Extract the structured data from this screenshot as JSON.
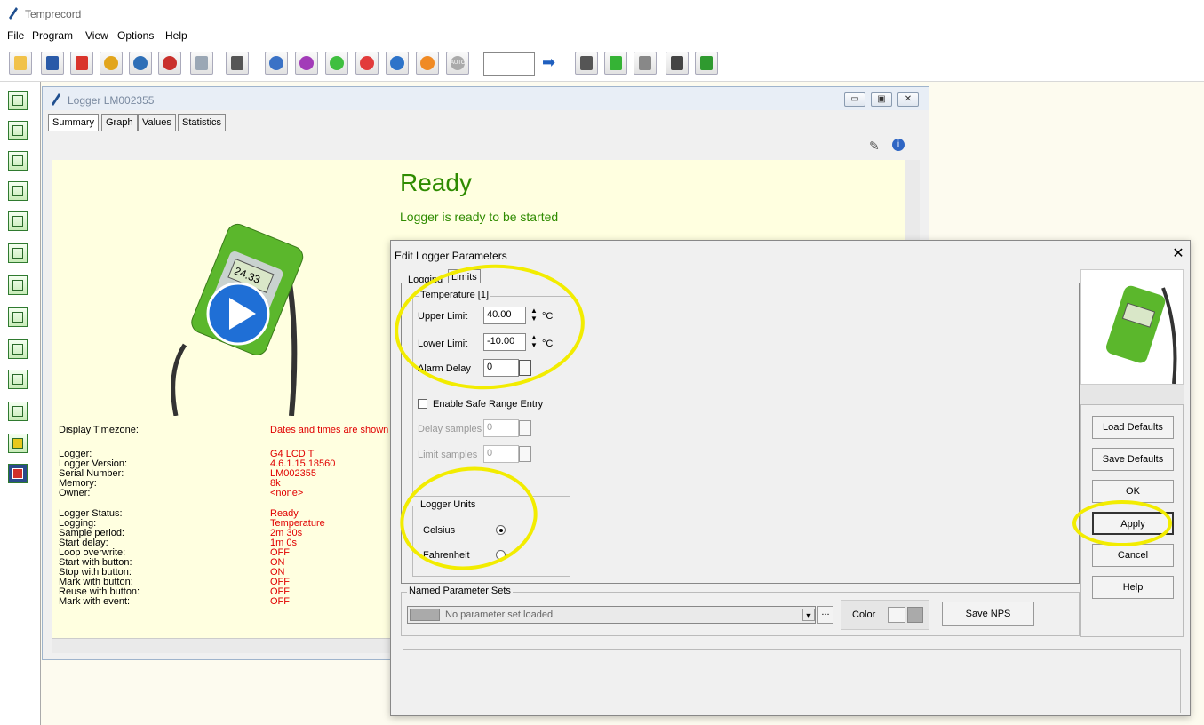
{
  "app": {
    "title": "Temprecord"
  },
  "menu": [
    "File",
    "Program",
    "View",
    "Options",
    "Help"
  ],
  "toolbar": {
    "buttons": [
      "open-icon",
      "save-icon",
      "pdf-icon",
      "export-icon",
      "globe-icon",
      "sync-icon",
      "email-icon",
      "print-icon",
      "help-icon",
      "list-icon",
      "start-icon",
      "stop-icon",
      "download-icon",
      "settings-icon",
      "auto-icon"
    ],
    "auto_label": "AUTO",
    "input_value": "",
    "post_buttons": [
      "go-arrow-icon",
      "calc-icon",
      "flag-icon",
      "chequered-flag-icon",
      "clipboard-icon",
      "report-icon"
    ]
  },
  "sidebar": {
    "count": 13
  },
  "logger_window": {
    "title": "Logger LM002355",
    "tabs": [
      "Summary",
      "Graph",
      "Values",
      "Statistics"
    ],
    "status": "Ready",
    "status_sub": "Logger is ready to be started",
    "rows": [
      {
        "label": "Display Timezone:",
        "value": "Dates and times are shown i"
      },
      {
        "label": "Logger:",
        "value": "G4 LCD T"
      },
      {
        "label": "Logger Version:",
        "value": "4.6.1.15.18560"
      },
      {
        "label": "Serial Number:",
        "value": "LM002355"
      },
      {
        "label": "Memory:",
        "value": "8k"
      },
      {
        "label": "Owner:",
        "value": "<none>"
      },
      {
        "label": "Logger Status:",
        "value": "Ready"
      },
      {
        "label": "Logging:",
        "value": "Temperature"
      },
      {
        "label": "Sample period:",
        "value": "2m 30s"
      },
      {
        "label": "Start delay:",
        "value": "1m 0s"
      },
      {
        "label": "Loop overwrite:",
        "value": "OFF"
      },
      {
        "label": "Start with button:",
        "value": "ON"
      },
      {
        "label": "Stop with button:",
        "value": "ON"
      },
      {
        "label": "Mark with button:",
        "value": "OFF"
      },
      {
        "label": "Reuse with button:",
        "value": "OFF"
      },
      {
        "label": "Mark with event:",
        "value": "OFF"
      }
    ],
    "device_lcd": "24.33"
  },
  "dialog": {
    "title": "Edit Logger Parameters",
    "tabs": [
      "Logging",
      "Limits"
    ],
    "temperature_group": "Temperature [1]",
    "upper_limit_label": "Upper Limit",
    "upper_limit_value": "40.00",
    "lower_limit_label": "Lower Limit",
    "lower_limit_value": "-10.00",
    "unit": "°C",
    "alarm_delay_label": "Alarm Delay",
    "alarm_delay_value": "0",
    "safe_range_label": "Enable Safe Range Entry",
    "delay_samples_label": "Delay samples",
    "delay_samples_value": "0",
    "limit_samples_label": "Limit samples",
    "limit_samples_value": "0",
    "units_group": "Logger Units",
    "celsius_label": "Celsius",
    "fahrenheit_label": "Fahrenheit",
    "nps_group": "Named Parameter Sets",
    "nps_value": "No parameter set loaded",
    "ellipsis": "...",
    "color_label": "Color",
    "save_nps": "Save NPS",
    "buttons": {
      "load_defaults": "Load Defaults",
      "save_defaults": "Save Defaults",
      "ok": "OK",
      "apply": "Apply",
      "cancel": "Cancel",
      "help": "Help"
    }
  }
}
